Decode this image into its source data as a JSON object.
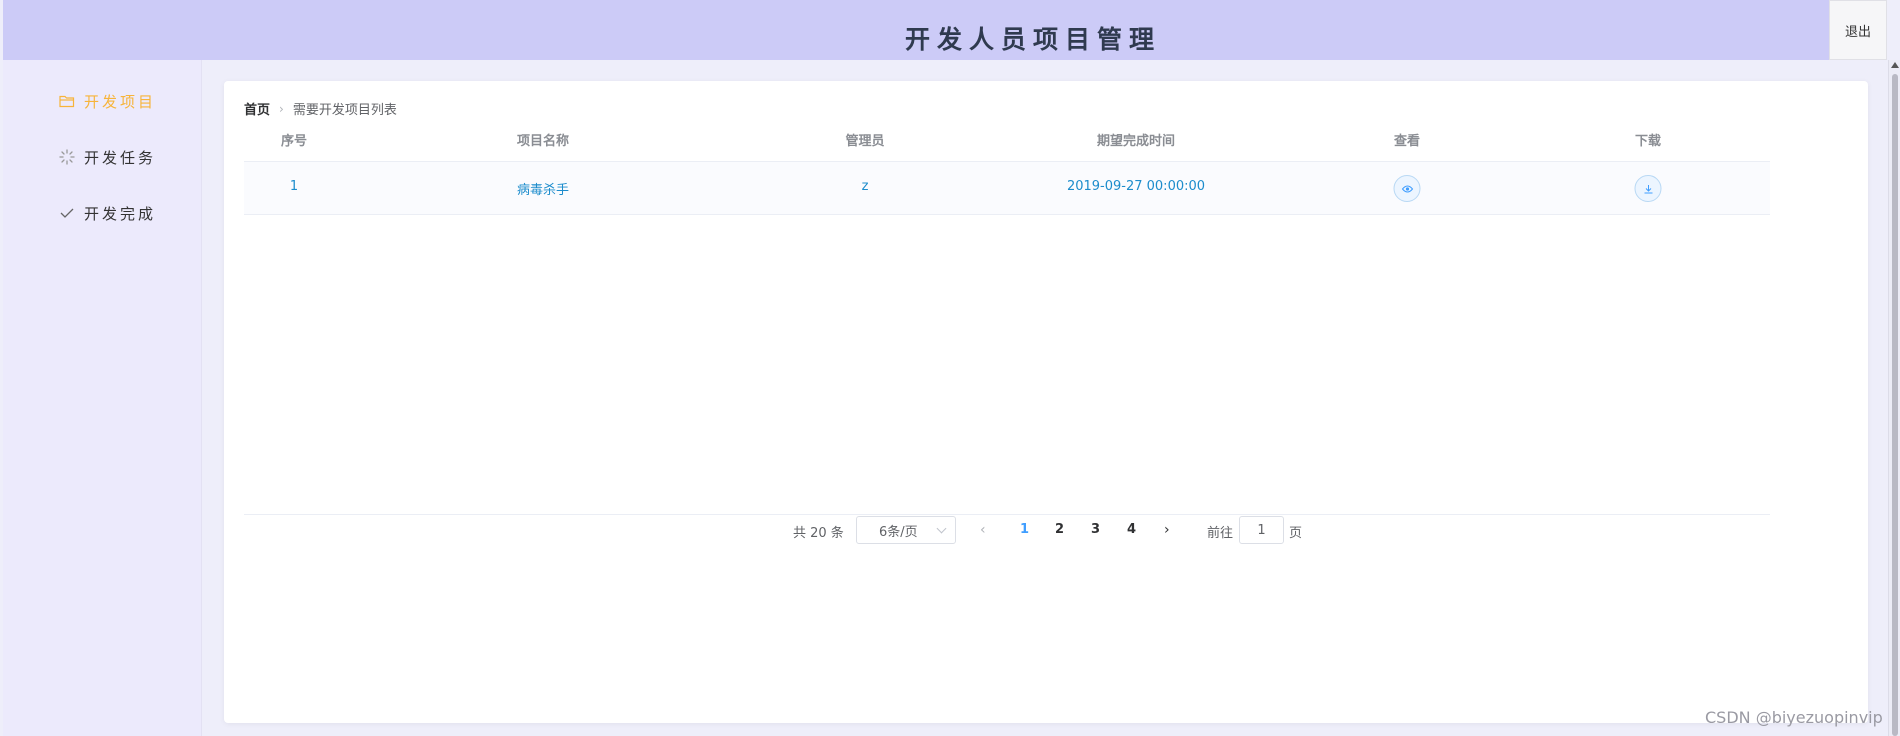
{
  "header": {
    "title": "开发人员项目管理",
    "logout_label": "退出"
  },
  "sidebar": {
    "items": [
      {
        "label": "开发项目",
        "icon": "folder-icon",
        "active": true
      },
      {
        "label": "开发任务",
        "icon": "loading-icon",
        "active": false
      },
      {
        "label": "开发完成",
        "icon": "check-icon",
        "active": false
      }
    ]
  },
  "breadcrumb": {
    "home": "首页",
    "current": "需要开发项目列表"
  },
  "table": {
    "columns": [
      "序号",
      "项目名称",
      "管理员",
      "期望完成时间",
      "查看",
      "下载"
    ],
    "rows": [
      {
        "index": "1",
        "name": "病毒杀手",
        "admin": "z",
        "deadline": "2019-09-27 00:00:00",
        "view_icon": "eye-icon",
        "download_icon": "download-icon"
      }
    ]
  },
  "pagination": {
    "total": "共 20 条",
    "page_size": "6条/页",
    "pages": [
      "1",
      "2",
      "3",
      "4"
    ],
    "current_page": "1",
    "goto_label": "前往",
    "goto_value": "1",
    "page_unit": "页"
  },
  "watermark": "CSDN @biyezuopinvip",
  "colors": {
    "header_bg": "#cccbf7",
    "sidebar_bg": "#eceafc",
    "active_menu": "#f7b43a",
    "link_blue": "#1c8ccc",
    "page_active": "#409eff"
  }
}
